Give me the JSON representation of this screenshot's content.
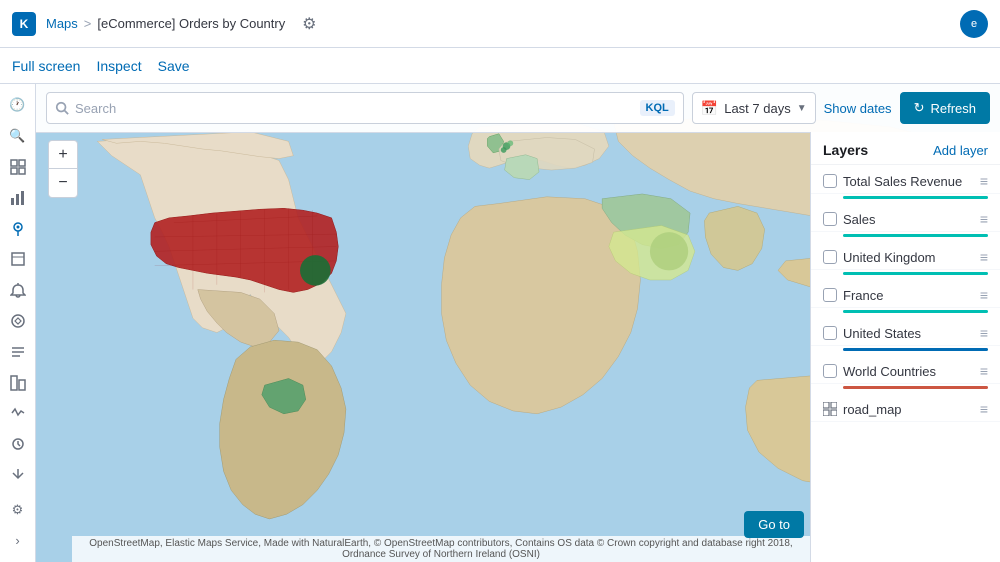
{
  "app": {
    "logo_text": "K",
    "maps_label": "Maps",
    "breadcrumb_separator": ">",
    "page_title": "[eCommerce] Orders by Country",
    "settings_icon": "⚙",
    "avatar_label": "e"
  },
  "action_bar": {
    "full_screen": "Full screen",
    "inspect": "Inspect",
    "save": "Save"
  },
  "toolbar": {
    "search_placeholder": "Search",
    "kql_label": "KQL",
    "calendar_icon": "📅",
    "time_range": "Last 7 days",
    "show_dates": "Show dates",
    "refresh_icon": "↻",
    "refresh_label": "Refresh"
  },
  "zoom": {
    "plus": "+",
    "minus": "−"
  },
  "layers_panel": {
    "title": "Layers",
    "add_layer": "Add layer",
    "items": [
      {
        "name": "Total Sales Revenue",
        "type": "checkbox",
        "color": "#00bfb3",
        "checked": false
      },
      {
        "name": "Sales",
        "type": "checkbox",
        "color": "#00bfb3",
        "checked": false
      },
      {
        "name": "United Kingdom",
        "type": "checkbox",
        "color": "#00bfb3",
        "checked": false
      },
      {
        "name": "France",
        "type": "checkbox",
        "color": "#00bfb3",
        "checked": false
      },
      {
        "name": "United States",
        "type": "checkbox",
        "color": "#006bb4",
        "checked": false
      },
      {
        "name": "World Countries",
        "type": "checkbox",
        "color": "#cc5642",
        "checked": false
      },
      {
        "name": "road_map",
        "type": "grid",
        "color": null,
        "checked": false
      }
    ]
  },
  "goto_label": "Go to",
  "attribution": "OpenStreetMap, Elastic Maps Service, Made with NaturalEarth, © OpenStreetMap contributors, Contains OS data © Crown copyright and database right 2018, Ordnance Survey of Northern Ireland (OSNI)",
  "sidebar_icons": [
    {
      "name": "clock-icon",
      "symbol": "🕐"
    },
    {
      "name": "search-icon",
      "symbol": "🔍"
    },
    {
      "name": "dashboard-icon",
      "symbol": "⊞"
    },
    {
      "name": "visualize-icon",
      "symbol": "📊"
    },
    {
      "name": "maps-icon",
      "symbol": "🗺"
    },
    {
      "name": "canvas-icon",
      "symbol": "◻"
    },
    {
      "name": "alerts-icon",
      "symbol": "🔔"
    },
    {
      "name": "ml-icon",
      "symbol": "◈"
    },
    {
      "name": "logs-icon",
      "symbol": "≡"
    },
    {
      "name": "infrastructure-icon",
      "symbol": "◫"
    },
    {
      "name": "apm-icon",
      "symbol": "◇"
    },
    {
      "name": "uptime-icon",
      "symbol": "○"
    },
    {
      "name": "dev-tools-icon",
      "symbol": "⌥"
    },
    {
      "name": "settings-icon",
      "symbol": "⚙"
    }
  ]
}
